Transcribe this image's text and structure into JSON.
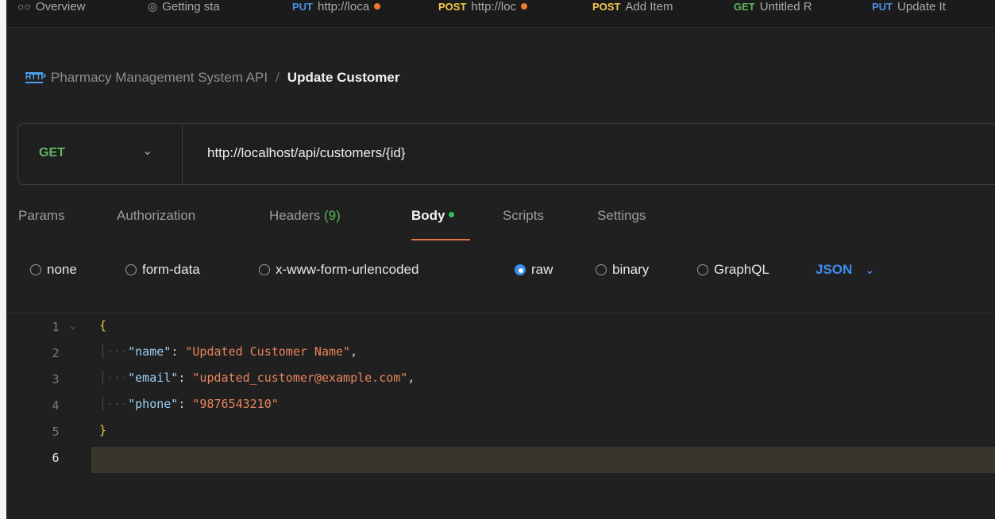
{
  "tabs": [
    {
      "method": "",
      "label": "Overview",
      "icon": "overview-icon",
      "dirty": false
    },
    {
      "method": "",
      "label": "Getting sta",
      "icon": "getting-started-icon",
      "dirty": false
    },
    {
      "method": "PUT",
      "label": "http://loca",
      "dirty": true
    },
    {
      "method": "POST",
      "label": "http://loc",
      "dirty": true
    },
    {
      "method": "POST",
      "label": "Add Item",
      "dirty": false
    },
    {
      "method": "GET",
      "label": "Untitled R",
      "dirty": false
    },
    {
      "method": "PUT",
      "label": "Update It",
      "dirty": false
    }
  ],
  "breadcrumb": {
    "icon_text": "HTTP",
    "parent": "Pharmacy Management System API",
    "separator": "/",
    "current": "Update Customer"
  },
  "request": {
    "method": "GET",
    "url": "http://localhost/api/customers/{id}"
  },
  "request_tabs": {
    "params": "Params",
    "authorization": "Authorization",
    "headers": "Headers",
    "headers_count": "(9)",
    "body": "Body",
    "scripts": "Scripts",
    "settings": "Settings"
  },
  "body_types": {
    "none": "none",
    "form_data": "form-data",
    "urlencoded": "x-www-form-urlencoded",
    "raw": "raw",
    "binary": "binary",
    "graphql": "GraphQL",
    "selected": "raw",
    "format": "JSON"
  },
  "editor": {
    "line_numbers": [
      "1",
      "2",
      "3",
      "4",
      "5",
      "6"
    ],
    "open_brace": "{",
    "close_brace": "}",
    "fields": [
      {
        "key": "\"name\"",
        "value": "\"Updated Customer Name\"",
        "trailing": ","
      },
      {
        "key": "\"email\"",
        "value": "\"updated_customer@example.com\"",
        "trailing": ","
      },
      {
        "key": "\"phone\"",
        "value": "\"9876543210\"",
        "trailing": ""
      }
    ],
    "current_line": "6"
  },
  "colors": {
    "accent_orange": "#e2733a",
    "get_green": "#63b663",
    "put_blue": "#4a8fe0",
    "post_yellow": "#f2c94c",
    "json_blue": "#3d8cf0"
  }
}
